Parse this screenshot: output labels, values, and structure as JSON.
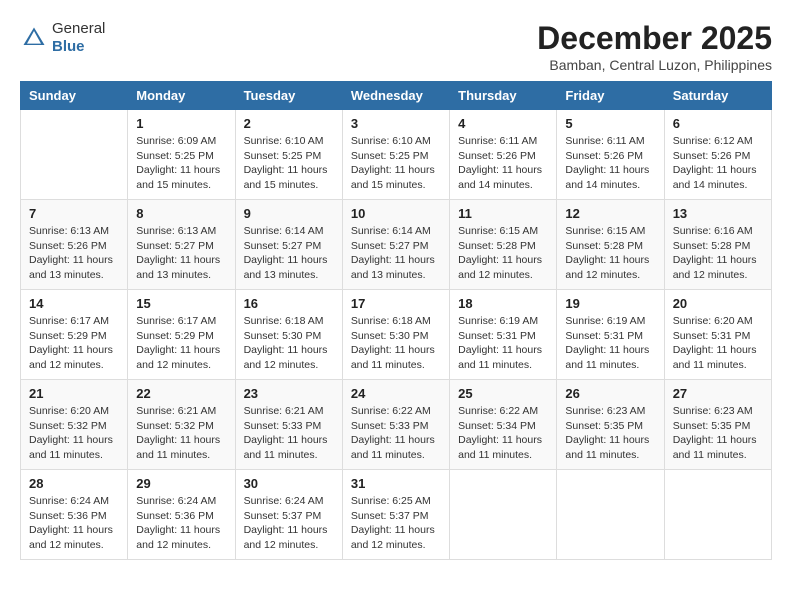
{
  "header": {
    "logo_general": "General",
    "logo_blue": "Blue",
    "month_title": "December 2025",
    "location": "Bamban, Central Luzon, Philippines"
  },
  "days_of_week": [
    "Sunday",
    "Monday",
    "Tuesday",
    "Wednesday",
    "Thursday",
    "Friday",
    "Saturday"
  ],
  "weeks": [
    [
      {
        "day": "",
        "info": ""
      },
      {
        "day": "1",
        "info": "Sunrise: 6:09 AM\nSunset: 5:25 PM\nDaylight: 11 hours\nand 15 minutes."
      },
      {
        "day": "2",
        "info": "Sunrise: 6:10 AM\nSunset: 5:25 PM\nDaylight: 11 hours\nand 15 minutes."
      },
      {
        "day": "3",
        "info": "Sunrise: 6:10 AM\nSunset: 5:25 PM\nDaylight: 11 hours\nand 15 minutes."
      },
      {
        "day": "4",
        "info": "Sunrise: 6:11 AM\nSunset: 5:26 PM\nDaylight: 11 hours\nand 14 minutes."
      },
      {
        "day": "5",
        "info": "Sunrise: 6:11 AM\nSunset: 5:26 PM\nDaylight: 11 hours\nand 14 minutes."
      },
      {
        "day": "6",
        "info": "Sunrise: 6:12 AM\nSunset: 5:26 PM\nDaylight: 11 hours\nand 14 minutes."
      }
    ],
    [
      {
        "day": "7",
        "info": "Sunrise: 6:13 AM\nSunset: 5:26 PM\nDaylight: 11 hours\nand 13 minutes."
      },
      {
        "day": "8",
        "info": "Sunrise: 6:13 AM\nSunset: 5:27 PM\nDaylight: 11 hours\nand 13 minutes."
      },
      {
        "day": "9",
        "info": "Sunrise: 6:14 AM\nSunset: 5:27 PM\nDaylight: 11 hours\nand 13 minutes."
      },
      {
        "day": "10",
        "info": "Sunrise: 6:14 AM\nSunset: 5:27 PM\nDaylight: 11 hours\nand 13 minutes."
      },
      {
        "day": "11",
        "info": "Sunrise: 6:15 AM\nSunset: 5:28 PM\nDaylight: 11 hours\nand 12 minutes."
      },
      {
        "day": "12",
        "info": "Sunrise: 6:15 AM\nSunset: 5:28 PM\nDaylight: 11 hours\nand 12 minutes."
      },
      {
        "day": "13",
        "info": "Sunrise: 6:16 AM\nSunset: 5:28 PM\nDaylight: 11 hours\nand 12 minutes."
      }
    ],
    [
      {
        "day": "14",
        "info": "Sunrise: 6:17 AM\nSunset: 5:29 PM\nDaylight: 11 hours\nand 12 minutes."
      },
      {
        "day": "15",
        "info": "Sunrise: 6:17 AM\nSunset: 5:29 PM\nDaylight: 11 hours\nand 12 minutes."
      },
      {
        "day": "16",
        "info": "Sunrise: 6:18 AM\nSunset: 5:30 PM\nDaylight: 11 hours\nand 12 minutes."
      },
      {
        "day": "17",
        "info": "Sunrise: 6:18 AM\nSunset: 5:30 PM\nDaylight: 11 hours\nand 11 minutes."
      },
      {
        "day": "18",
        "info": "Sunrise: 6:19 AM\nSunset: 5:31 PM\nDaylight: 11 hours\nand 11 minutes."
      },
      {
        "day": "19",
        "info": "Sunrise: 6:19 AM\nSunset: 5:31 PM\nDaylight: 11 hours\nand 11 minutes."
      },
      {
        "day": "20",
        "info": "Sunrise: 6:20 AM\nSunset: 5:31 PM\nDaylight: 11 hours\nand 11 minutes."
      }
    ],
    [
      {
        "day": "21",
        "info": "Sunrise: 6:20 AM\nSunset: 5:32 PM\nDaylight: 11 hours\nand 11 minutes."
      },
      {
        "day": "22",
        "info": "Sunrise: 6:21 AM\nSunset: 5:32 PM\nDaylight: 11 hours\nand 11 minutes."
      },
      {
        "day": "23",
        "info": "Sunrise: 6:21 AM\nSunset: 5:33 PM\nDaylight: 11 hours\nand 11 minutes."
      },
      {
        "day": "24",
        "info": "Sunrise: 6:22 AM\nSunset: 5:33 PM\nDaylight: 11 hours\nand 11 minutes."
      },
      {
        "day": "25",
        "info": "Sunrise: 6:22 AM\nSunset: 5:34 PM\nDaylight: 11 hours\nand 11 minutes."
      },
      {
        "day": "26",
        "info": "Sunrise: 6:23 AM\nSunset: 5:35 PM\nDaylight: 11 hours\nand 11 minutes."
      },
      {
        "day": "27",
        "info": "Sunrise: 6:23 AM\nSunset: 5:35 PM\nDaylight: 11 hours\nand 11 minutes."
      }
    ],
    [
      {
        "day": "28",
        "info": "Sunrise: 6:24 AM\nSunset: 5:36 PM\nDaylight: 11 hours\nand 12 minutes."
      },
      {
        "day": "29",
        "info": "Sunrise: 6:24 AM\nSunset: 5:36 PM\nDaylight: 11 hours\nand 12 minutes."
      },
      {
        "day": "30",
        "info": "Sunrise: 6:24 AM\nSunset: 5:37 PM\nDaylight: 11 hours\nand 12 minutes."
      },
      {
        "day": "31",
        "info": "Sunrise: 6:25 AM\nSunset: 5:37 PM\nDaylight: 11 hours\nand 12 minutes."
      },
      {
        "day": "",
        "info": ""
      },
      {
        "day": "",
        "info": ""
      },
      {
        "day": "",
        "info": ""
      }
    ]
  ]
}
